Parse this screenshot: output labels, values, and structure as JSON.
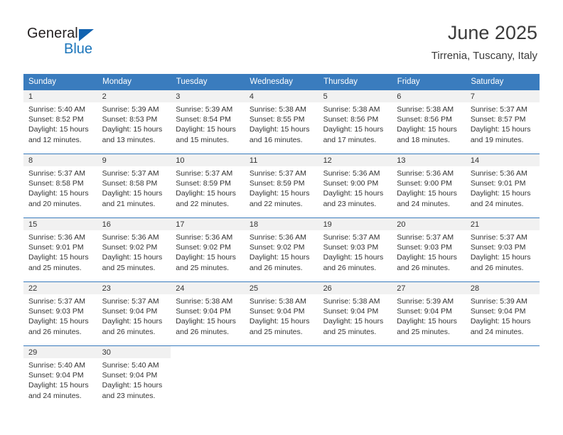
{
  "logo": {
    "word_one": "General",
    "word_two": "Blue",
    "triangle": "blue-triangle-icon",
    "brand_blue": "#1b75bb",
    "brand_dark": "#231f20"
  },
  "header": {
    "title": "June 2025",
    "subtitle": "Tirrenia, Tuscany, Italy"
  },
  "calendar": {
    "header_bg": "#3a7cbe",
    "daynum_bg": "#f1f1f1",
    "weekdays": [
      "Sunday",
      "Monday",
      "Tuesday",
      "Wednesday",
      "Thursday",
      "Friday",
      "Saturday"
    ],
    "weeks": [
      [
        {
          "day": "1",
          "sunrise": "Sunrise: 5:40 AM",
          "sunset": "Sunset: 8:52 PM",
          "daylight_line1": "Daylight: 15 hours",
          "daylight_line2": "and 12 minutes."
        },
        {
          "day": "2",
          "sunrise": "Sunrise: 5:39 AM",
          "sunset": "Sunset: 8:53 PM",
          "daylight_line1": "Daylight: 15 hours",
          "daylight_line2": "and 13 minutes."
        },
        {
          "day": "3",
          "sunrise": "Sunrise: 5:39 AM",
          "sunset": "Sunset: 8:54 PM",
          "daylight_line1": "Daylight: 15 hours",
          "daylight_line2": "and 15 minutes."
        },
        {
          "day": "4",
          "sunrise": "Sunrise: 5:38 AM",
          "sunset": "Sunset: 8:55 PM",
          "daylight_line1": "Daylight: 15 hours",
          "daylight_line2": "and 16 minutes."
        },
        {
          "day": "5",
          "sunrise": "Sunrise: 5:38 AM",
          "sunset": "Sunset: 8:56 PM",
          "daylight_line1": "Daylight: 15 hours",
          "daylight_line2": "and 17 minutes."
        },
        {
          "day": "6",
          "sunrise": "Sunrise: 5:38 AM",
          "sunset": "Sunset: 8:56 PM",
          "daylight_line1": "Daylight: 15 hours",
          "daylight_line2": "and 18 minutes."
        },
        {
          "day": "7",
          "sunrise": "Sunrise: 5:37 AM",
          "sunset": "Sunset: 8:57 PM",
          "daylight_line1": "Daylight: 15 hours",
          "daylight_line2": "and 19 minutes."
        }
      ],
      [
        {
          "day": "8",
          "sunrise": "Sunrise: 5:37 AM",
          "sunset": "Sunset: 8:58 PM",
          "daylight_line1": "Daylight: 15 hours",
          "daylight_line2": "and 20 minutes."
        },
        {
          "day": "9",
          "sunrise": "Sunrise: 5:37 AM",
          "sunset": "Sunset: 8:58 PM",
          "daylight_line1": "Daylight: 15 hours",
          "daylight_line2": "and 21 minutes."
        },
        {
          "day": "10",
          "sunrise": "Sunrise: 5:37 AM",
          "sunset": "Sunset: 8:59 PM",
          "daylight_line1": "Daylight: 15 hours",
          "daylight_line2": "and 22 minutes."
        },
        {
          "day": "11",
          "sunrise": "Sunrise: 5:37 AM",
          "sunset": "Sunset: 8:59 PM",
          "daylight_line1": "Daylight: 15 hours",
          "daylight_line2": "and 22 minutes."
        },
        {
          "day": "12",
          "sunrise": "Sunrise: 5:36 AM",
          "sunset": "Sunset: 9:00 PM",
          "daylight_line1": "Daylight: 15 hours",
          "daylight_line2": "and 23 minutes."
        },
        {
          "day": "13",
          "sunrise": "Sunrise: 5:36 AM",
          "sunset": "Sunset: 9:00 PM",
          "daylight_line1": "Daylight: 15 hours",
          "daylight_line2": "and 24 minutes."
        },
        {
          "day": "14",
          "sunrise": "Sunrise: 5:36 AM",
          "sunset": "Sunset: 9:01 PM",
          "daylight_line1": "Daylight: 15 hours",
          "daylight_line2": "and 24 minutes."
        }
      ],
      [
        {
          "day": "15",
          "sunrise": "Sunrise: 5:36 AM",
          "sunset": "Sunset: 9:01 PM",
          "daylight_line1": "Daylight: 15 hours",
          "daylight_line2": "and 25 minutes."
        },
        {
          "day": "16",
          "sunrise": "Sunrise: 5:36 AM",
          "sunset": "Sunset: 9:02 PM",
          "daylight_line1": "Daylight: 15 hours",
          "daylight_line2": "and 25 minutes."
        },
        {
          "day": "17",
          "sunrise": "Sunrise: 5:36 AM",
          "sunset": "Sunset: 9:02 PM",
          "daylight_line1": "Daylight: 15 hours",
          "daylight_line2": "and 25 minutes."
        },
        {
          "day": "18",
          "sunrise": "Sunrise: 5:36 AM",
          "sunset": "Sunset: 9:02 PM",
          "daylight_line1": "Daylight: 15 hours",
          "daylight_line2": "and 26 minutes."
        },
        {
          "day": "19",
          "sunrise": "Sunrise: 5:37 AM",
          "sunset": "Sunset: 9:03 PM",
          "daylight_line1": "Daylight: 15 hours",
          "daylight_line2": "and 26 minutes."
        },
        {
          "day": "20",
          "sunrise": "Sunrise: 5:37 AM",
          "sunset": "Sunset: 9:03 PM",
          "daylight_line1": "Daylight: 15 hours",
          "daylight_line2": "and 26 minutes."
        },
        {
          "day": "21",
          "sunrise": "Sunrise: 5:37 AM",
          "sunset": "Sunset: 9:03 PM",
          "daylight_line1": "Daylight: 15 hours",
          "daylight_line2": "and 26 minutes."
        }
      ],
      [
        {
          "day": "22",
          "sunrise": "Sunrise: 5:37 AM",
          "sunset": "Sunset: 9:03 PM",
          "daylight_line1": "Daylight: 15 hours",
          "daylight_line2": "and 26 minutes."
        },
        {
          "day": "23",
          "sunrise": "Sunrise: 5:37 AM",
          "sunset": "Sunset: 9:04 PM",
          "daylight_line1": "Daylight: 15 hours",
          "daylight_line2": "and 26 minutes."
        },
        {
          "day": "24",
          "sunrise": "Sunrise: 5:38 AM",
          "sunset": "Sunset: 9:04 PM",
          "daylight_line1": "Daylight: 15 hours",
          "daylight_line2": "and 26 minutes."
        },
        {
          "day": "25",
          "sunrise": "Sunrise: 5:38 AM",
          "sunset": "Sunset: 9:04 PM",
          "daylight_line1": "Daylight: 15 hours",
          "daylight_line2": "and 25 minutes."
        },
        {
          "day": "26",
          "sunrise": "Sunrise: 5:38 AM",
          "sunset": "Sunset: 9:04 PM",
          "daylight_line1": "Daylight: 15 hours",
          "daylight_line2": "and 25 minutes."
        },
        {
          "day": "27",
          "sunrise": "Sunrise: 5:39 AM",
          "sunset": "Sunset: 9:04 PM",
          "daylight_line1": "Daylight: 15 hours",
          "daylight_line2": "and 25 minutes."
        },
        {
          "day": "28",
          "sunrise": "Sunrise: 5:39 AM",
          "sunset": "Sunset: 9:04 PM",
          "daylight_line1": "Daylight: 15 hours",
          "daylight_line2": "and 24 minutes."
        }
      ],
      [
        {
          "day": "29",
          "sunrise": "Sunrise: 5:40 AM",
          "sunset": "Sunset: 9:04 PM",
          "daylight_line1": "Daylight: 15 hours",
          "daylight_line2": "and 24 minutes."
        },
        {
          "day": "30",
          "sunrise": "Sunrise: 5:40 AM",
          "sunset": "Sunset: 9:04 PM",
          "daylight_line1": "Daylight: 15 hours",
          "daylight_line2": "and 23 minutes."
        },
        null,
        null,
        null,
        null,
        null
      ]
    ]
  }
}
